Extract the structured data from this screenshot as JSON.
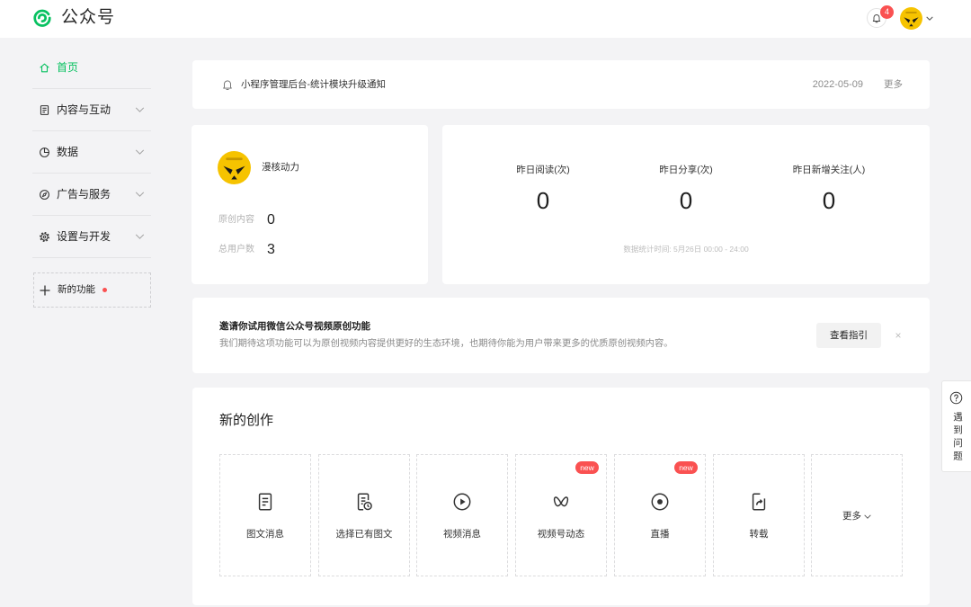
{
  "app": {
    "title": "公众号",
    "logo_icon": "wechat-official-account-logo"
  },
  "header": {
    "notification_icon": "bell-icon",
    "notification_count": "4",
    "avatar_menu_icon": "chevron-down-icon"
  },
  "sidebar": {
    "items": [
      {
        "label": "首页",
        "icon": "home-icon",
        "active": true
      },
      {
        "label": "内容与互动",
        "icon": "document-icon",
        "expandable": true
      },
      {
        "label": "数据",
        "icon": "pie-chart-icon",
        "expandable": true
      },
      {
        "label": "广告与服务",
        "icon": "compass-icon",
        "expandable": true
      },
      {
        "label": "设置与开发",
        "icon": "gear-icon",
        "expandable": true
      }
    ],
    "new_feature": {
      "label": "新的功能",
      "icon": "plus-icon",
      "has_dot": true
    }
  },
  "notice": {
    "icon": "bell-icon",
    "text": "小程序管理后台-统计模块升级通知",
    "date": "2022-05-09",
    "more_label": "更多"
  },
  "account": {
    "name": "漫核动力",
    "stats": [
      {
        "label": "原创内容",
        "value": "0"
      },
      {
        "label": "总用户数",
        "value": "3"
      }
    ]
  },
  "overview": {
    "stats": [
      {
        "label": "昨日阅读(次)",
        "value": "0"
      },
      {
        "label": "昨日分享(次)",
        "value": "0"
      },
      {
        "label": "昨日新增关注(人)",
        "value": "0"
      }
    ],
    "footer": "数据统计时间: 5月26日 00:00 - 24:00"
  },
  "banner": {
    "title": "邀请你试用微信公众号视频原创功能",
    "description": "我们期待这项功能可以为原创视频内容提供更好的生态环境，也期待你能为用户带来更多的优质原创视频内容。",
    "button_label": "查看指引",
    "close_label": "×"
  },
  "creation": {
    "title": "新的创作",
    "tiles": [
      {
        "label": "图文消息",
        "icon": "article-icon"
      },
      {
        "label": "选择已有图文",
        "icon": "article-history-icon"
      },
      {
        "label": "视频消息",
        "icon": "video-play-icon"
      },
      {
        "label": "视频号动态",
        "icon": "channels-icon",
        "badge": "new"
      },
      {
        "label": "直播",
        "icon": "live-icon",
        "badge": "new"
      },
      {
        "label": "转载",
        "icon": "repost-icon"
      }
    ],
    "more_label": "更多"
  },
  "help": {
    "icon": "help-circle-icon",
    "label": "遇到问题"
  },
  "theme": {
    "accent": "#07c160",
    "danger": "#fa5151",
    "background": "#f3f3f5"
  }
}
